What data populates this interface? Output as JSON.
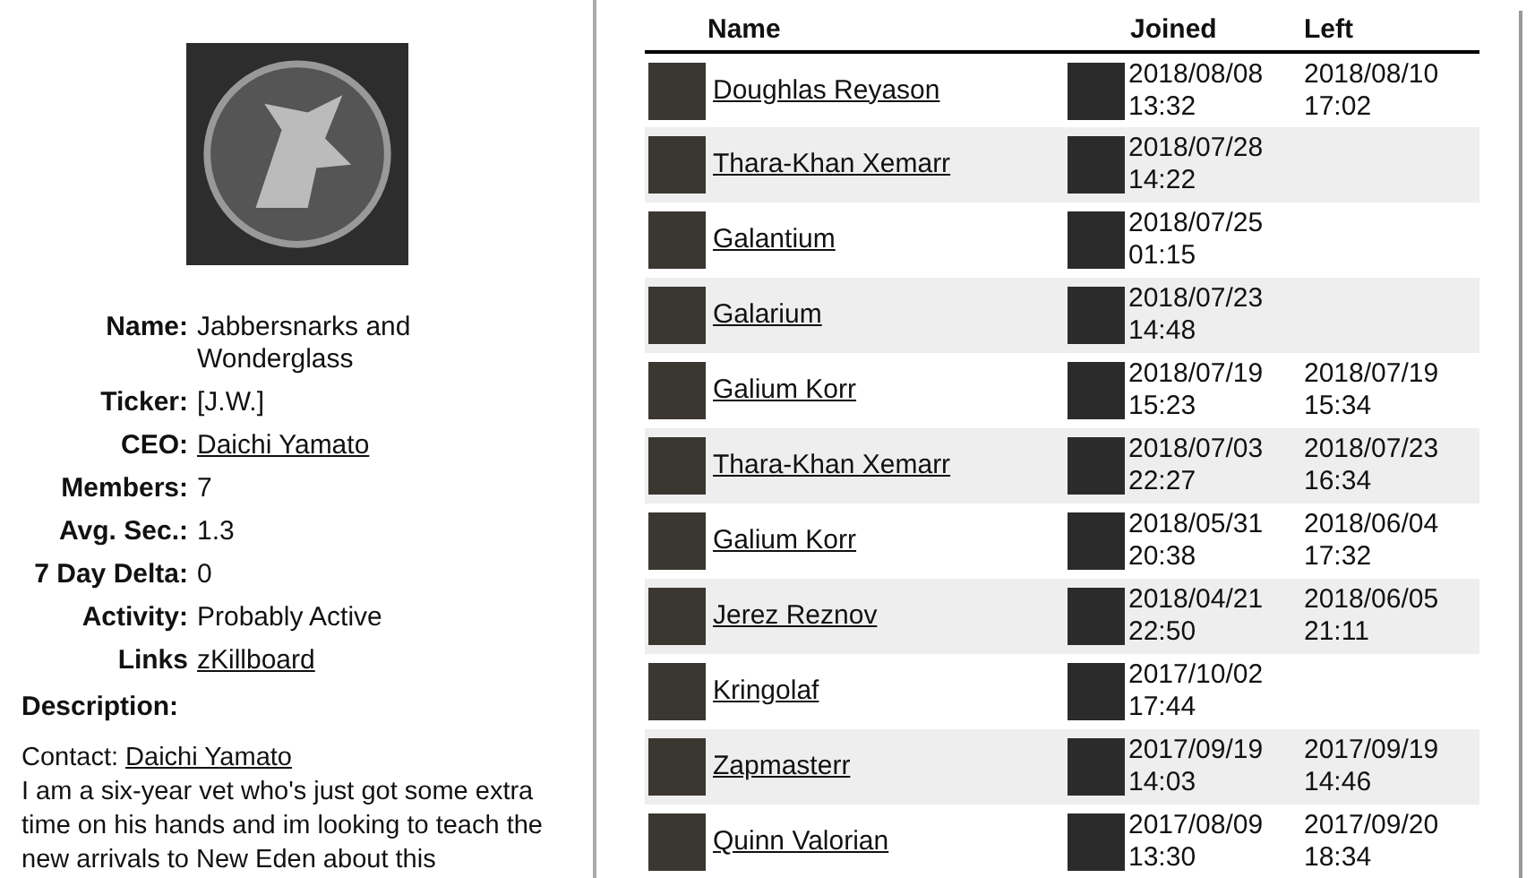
{
  "corporation": {
    "details": [
      {
        "label": "Name:",
        "value": "Jabbersnarks and Wonderglass",
        "kind": "text"
      },
      {
        "label": "Ticker:",
        "value": "[J.W.]",
        "kind": "text"
      },
      {
        "label": "CEO:",
        "value": "Daichi Yamato",
        "kind": "link"
      },
      {
        "label": "Members:",
        "value": "7",
        "kind": "text"
      },
      {
        "label": "Avg. Sec.:",
        "value": "1.3",
        "kind": "text"
      },
      {
        "label": "7 Day Delta:",
        "value": "0",
        "kind": "text"
      },
      {
        "label": "Activity:",
        "value": "Probably Active",
        "kind": "text"
      },
      {
        "label": "Links",
        "value": "zKillboard",
        "kind": "link"
      }
    ],
    "description_heading": "Description:",
    "contact_label": "Contact:",
    "contact_name": "Daichi Yamato",
    "description": "I am a six-year vet who's just got some extra time on his hands and im looking to teach the new arrivals to New Eden about this"
  },
  "history": {
    "columns": [
      "Name",
      "Joined",
      "Left"
    ],
    "rows": [
      {
        "name": "Doughlas Reyason",
        "joined_date": "2018/08/08",
        "joined_time": "13:32",
        "left_date": "2018/08/10",
        "left_time": "17:02"
      },
      {
        "name": "Thara-Khan Xemarr",
        "joined_date": "2018/07/28",
        "joined_time": "14:22"
      },
      {
        "name": "Galantium",
        "joined_date": "2018/07/25",
        "joined_time": "01:15"
      },
      {
        "name": "Galarium",
        "joined_date": "2018/07/23",
        "joined_time": "14:48"
      },
      {
        "name": "Galium Korr",
        "joined_date": "2018/07/19",
        "joined_time": "15:23",
        "left_date": "2018/07/19",
        "left_time": "15:34"
      },
      {
        "name": "Thara-Khan Xemarr",
        "joined_date": "2018/07/03",
        "joined_time": "22:27",
        "left_date": "2018/07/23",
        "left_time": "16:34"
      },
      {
        "name": "Galium Korr",
        "joined_date": "2018/05/31",
        "joined_time": "20:38",
        "left_date": "2018/06/04",
        "left_time": "17:32"
      },
      {
        "name": "Jerez Reznov",
        "joined_date": "2018/04/21",
        "joined_time": "22:50",
        "left_date": "2018/06/05",
        "left_time": "21:11"
      },
      {
        "name": "Kringolaf",
        "joined_date": "2017/10/02",
        "joined_time": "17:44"
      },
      {
        "name": "Zapmasterr",
        "joined_date": "2017/09/19",
        "joined_time": "14:03",
        "left_date": "2017/09/19",
        "left_time": "14:46"
      },
      {
        "name": "Quinn Valorian",
        "joined_date": "2017/08/09",
        "joined_time": "13:30",
        "left_date": "2017/09/20",
        "left_time": "18:34"
      }
    ]
  }
}
